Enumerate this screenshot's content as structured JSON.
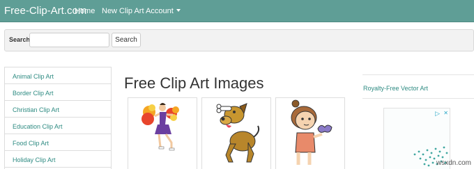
{
  "navbar": {
    "brand": "Free-Clip-Art.com",
    "links": [
      "Home",
      "New Clip Art"
    ],
    "account_label": "Account"
  },
  "search": {
    "label": "Search",
    "input_value": "",
    "button_label": "Search"
  },
  "sidebar": {
    "items": [
      {
        "label": "Animal Clip Art"
      },
      {
        "label": "Border Clip Art"
      },
      {
        "label": "Christian Clip Art"
      },
      {
        "label": "Education Clip Art"
      },
      {
        "label": "Food Clip Art"
      },
      {
        "label": "Holiday Clip Art"
      }
    ]
  },
  "main": {
    "title": "Free Clip Art Images",
    "images": [
      {
        "icon": "cheerleader-clipart"
      },
      {
        "icon": "dog-with-bone-clipart"
      },
      {
        "icon": "girl-with-butterfly-clipart"
      }
    ]
  },
  "right_panel": {
    "link": "Royalty-Free Vector Art",
    "ad": {
      "choices_icon": "adchoices-icon",
      "close_icon": "close-icon"
    }
  },
  "watermark": "wsxdn.com",
  "colors": {
    "navbar": "#5f9e96",
    "link": "#2e8b82",
    "search_bar": "#f2f2f2"
  }
}
